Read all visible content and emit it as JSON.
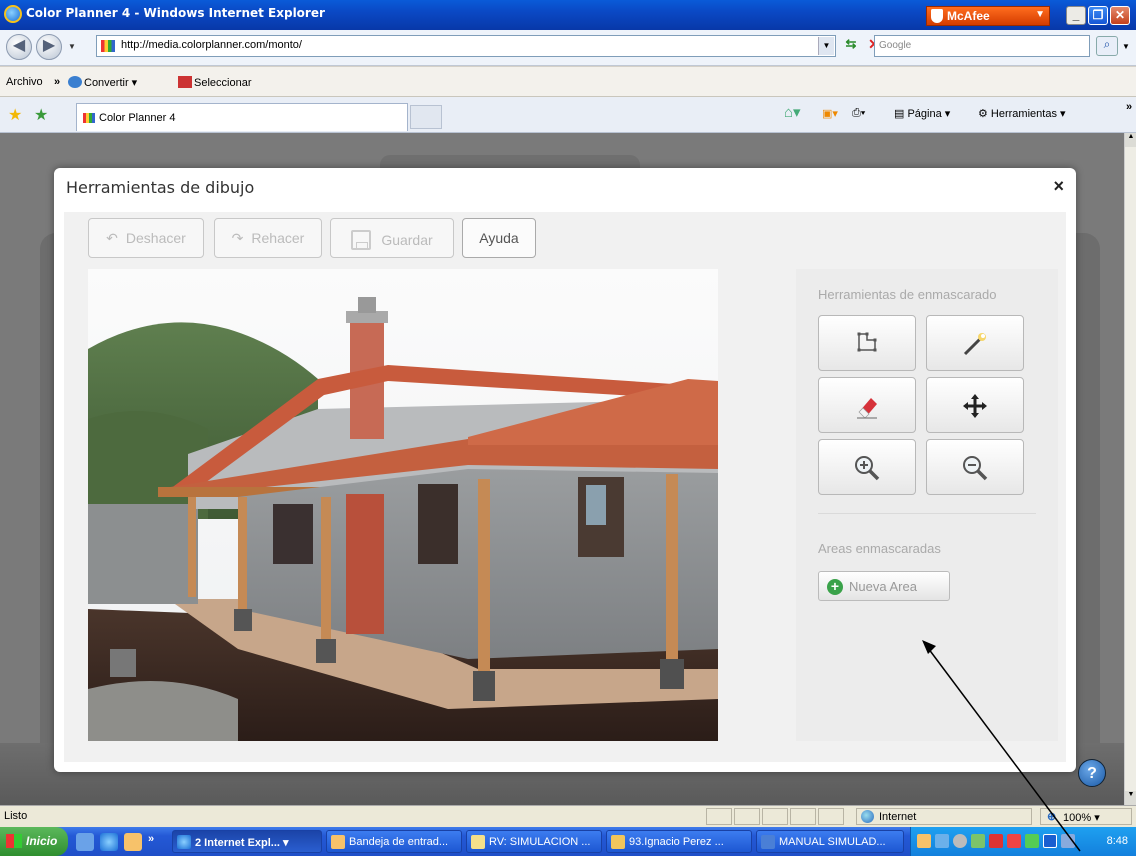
{
  "window": {
    "title": "Color Planner 4 - Windows Internet Explorer",
    "mcafee": "McAfee"
  },
  "addressbar": {
    "url": "http://media.colorplanner.com/monto/",
    "search_placeholder": "Google"
  },
  "menubar": {
    "archivo": "Archivo",
    "chevron": "»",
    "convertir": "Convertir",
    "seleccionar": "Seleccionar"
  },
  "tabs": {
    "active_tab": "Color Planner 4"
  },
  "commandbar": {
    "pagina": "Página",
    "herramientas": "Herramientas",
    "chevron": "»"
  },
  "modal": {
    "title": "Herramientas de dibujo",
    "close": "×",
    "toolbar": {
      "undo": "Deshacer",
      "redo": "Rehacer",
      "save": "Guardar",
      "help": "Ayuda"
    },
    "masking_tools_heading": "Herramientas de enmascarado",
    "masking_tools": [
      "polygon-tool-icon",
      "magic-wand-icon",
      "eraser-icon",
      "move-icon",
      "zoom-in-icon",
      "zoom-out-icon"
    ],
    "masked_areas_heading": "Areas enmascaradas",
    "new_area_button": "Nueva Area"
  },
  "statusbar": {
    "text": "Listo",
    "zone": "Internet",
    "zoom": "100%"
  },
  "taskbar": {
    "start": "Inicio",
    "chevron": "»",
    "tasks": [
      "2 Internet Expl...",
      "Bandeja de entrad...",
      "RV: SIMULACION ...",
      "93.Ignacio Perez ...",
      "MANUAL SIMULAD..."
    ],
    "clock": "8:48"
  },
  "help_bubble": "?"
}
